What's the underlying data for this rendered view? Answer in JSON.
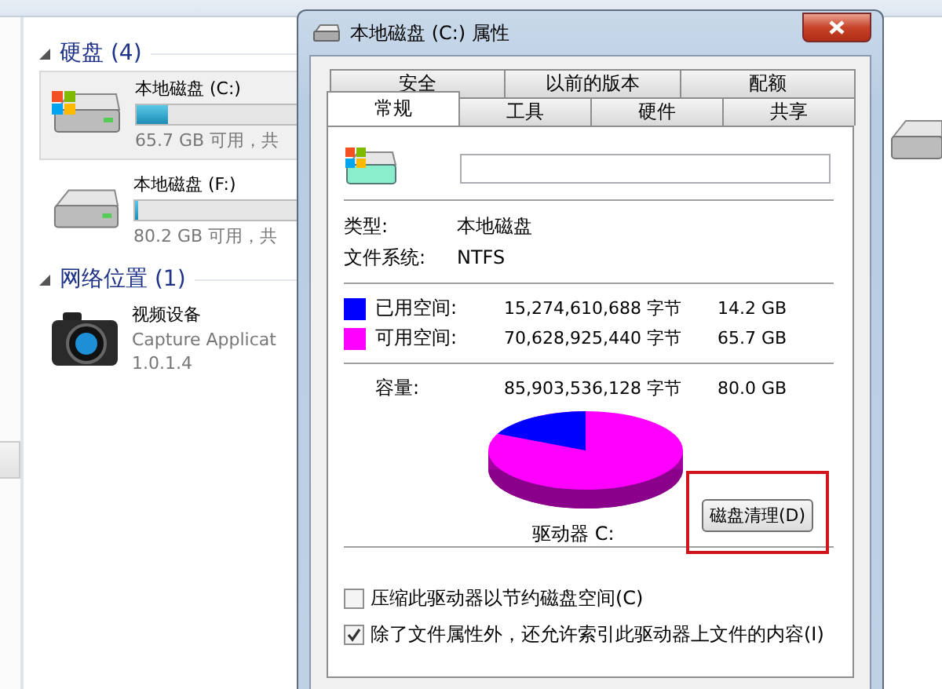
{
  "explorer": {
    "groups": [
      {
        "title": "硬盘 (4)",
        "expanded": true,
        "items": [
          {
            "kind": "drive",
            "system": true,
            "name": "本地磁盘 (C:)",
            "level": 0.18,
            "detail": "65.7 GB 可用，共",
            "selected": true
          },
          {
            "kind": "drive",
            "system": false,
            "name": "本地磁盘 (F:)",
            "level": 0.02,
            "detail": "80.2 GB 可用，共",
            "selected": false
          }
        ]
      },
      {
        "title": "网络位置 (1)",
        "expanded": true,
        "items": [
          {
            "kind": "device",
            "name": "视频设备",
            "detail": "Capture Applicat",
            "version": "1.0.1.4",
            "selected": false
          }
        ]
      }
    ]
  },
  "dialog": {
    "title": "本地磁盘 (C:) 属性",
    "tab_rows": [
      [
        {
          "label": "安全",
          "selected": false
        },
        {
          "label": "以前的版本",
          "selected": false
        },
        {
          "label": "配额",
          "selected": false
        }
      ],
      [
        {
          "label": "常规",
          "selected": true
        },
        {
          "label": "工具",
          "selected": false
        },
        {
          "label": "硬件",
          "selected": false
        },
        {
          "label": "共享",
          "selected": false
        }
      ]
    ],
    "info": [
      {
        "label": "类型:",
        "value": "本地磁盘"
      },
      {
        "label": "文件系统:",
        "value": "NTFS"
      }
    ],
    "space": [
      {
        "label": "已用空间:",
        "bytes": "15,274,610,688 字节",
        "size": "14.2 GB",
        "color": "#0000ff"
      },
      {
        "label": "可用空间:",
        "bytes": "70,628,925,440 字节",
        "size": "65.7 GB",
        "color": "#ff00ff"
      }
    ],
    "capacity": {
      "label": "容量:",
      "bytes": "85,903,536,128 字节",
      "size": "80.0 GB"
    },
    "drive_label": "驱动器 C:",
    "cleanup_button": "磁盘清理(D)",
    "options": [
      {
        "label": "压缩此驱动器以节约磁盘空间(C)",
        "checked": false
      },
      {
        "label": "除了文件属性外，还允许索引此驱动器上文件的内容(I)",
        "checked": true
      }
    ]
  }
}
